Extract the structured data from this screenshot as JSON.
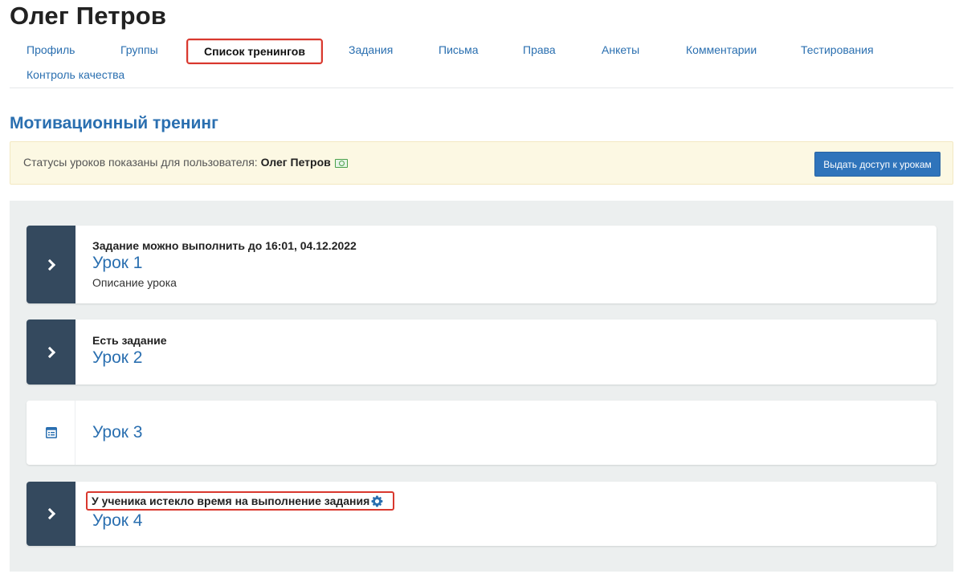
{
  "user_name": "Олег Петров",
  "tabs": [
    {
      "label": "Профиль",
      "active": false
    },
    {
      "label": "Группы",
      "active": false
    },
    {
      "label": "Список тренингов",
      "active": true
    },
    {
      "label": "Задания",
      "active": false
    },
    {
      "label": "Письма",
      "active": false
    },
    {
      "label": "Права",
      "active": false
    },
    {
      "label": "Анкеты",
      "active": false
    },
    {
      "label": "Комментарии",
      "active": false
    },
    {
      "label": "Тестирования",
      "active": false
    },
    {
      "label": "Контроль качества",
      "active": false
    }
  ],
  "training_title": "Мотивационный тренинг",
  "notice": {
    "text": "Статусы уроков показаны для пользователя:",
    "user": "Олег Петров",
    "button_label": "Выдать доступ к урокам"
  },
  "colors": {
    "accent": "#2a6fb0",
    "sidebar": "#34495e",
    "notice_bg": "#fcf8e3",
    "highlight": "#d9382e"
  },
  "lessons": [
    {
      "status": "Задание можно выполнить до 16:01, 04.12.2022",
      "name": "Урок 1",
      "description": "Описание урока",
      "icon": "chevron-right-icon"
    },
    {
      "status": "Есть задание",
      "name": "Урок 2",
      "description": "",
      "icon": "chevron-right-icon"
    },
    {
      "status": "",
      "name": "Урок 3",
      "description": "",
      "icon": "document-list-icon"
    },
    {
      "status": "У ученика истекло время на выполнение задания",
      "name": "Урок 4",
      "description": "",
      "icon": "chevron-right-icon"
    }
  ]
}
